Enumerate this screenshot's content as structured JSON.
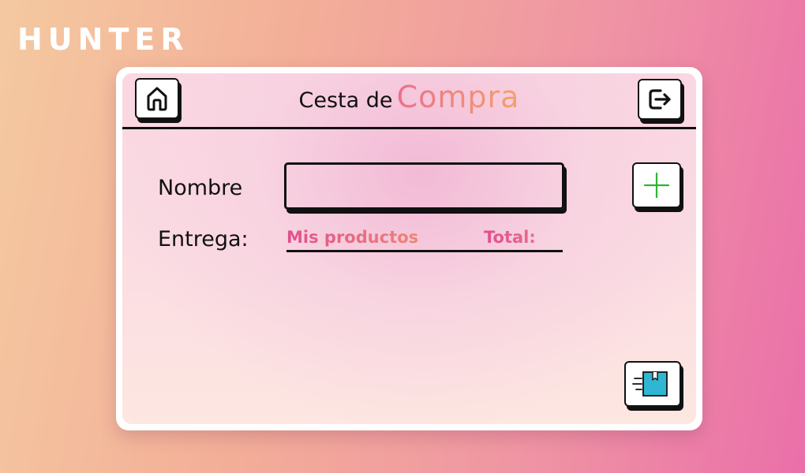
{
  "brand": {
    "name": "HUNTER"
  },
  "header": {
    "title_prefix": "Cesta de",
    "title_highlight": "Compra",
    "home_icon": "home-icon",
    "exit_icon": "logout-icon"
  },
  "form": {
    "name_label": "Nombre",
    "name_value": "",
    "name_placeholder": "",
    "delivery_label": "Entrega:",
    "add_icon": "plus-icon"
  },
  "products": {
    "tab_label": "Mis productos",
    "total_label": "Total:",
    "items": []
  },
  "actions": {
    "deliver_icon": "package-delivery-icon"
  },
  "colors": {
    "accent_pink": "#e0508f",
    "accent_orange": "#f2a26a",
    "plus_green": "#2db52d",
    "package_blue": "#2fb6d2"
  }
}
